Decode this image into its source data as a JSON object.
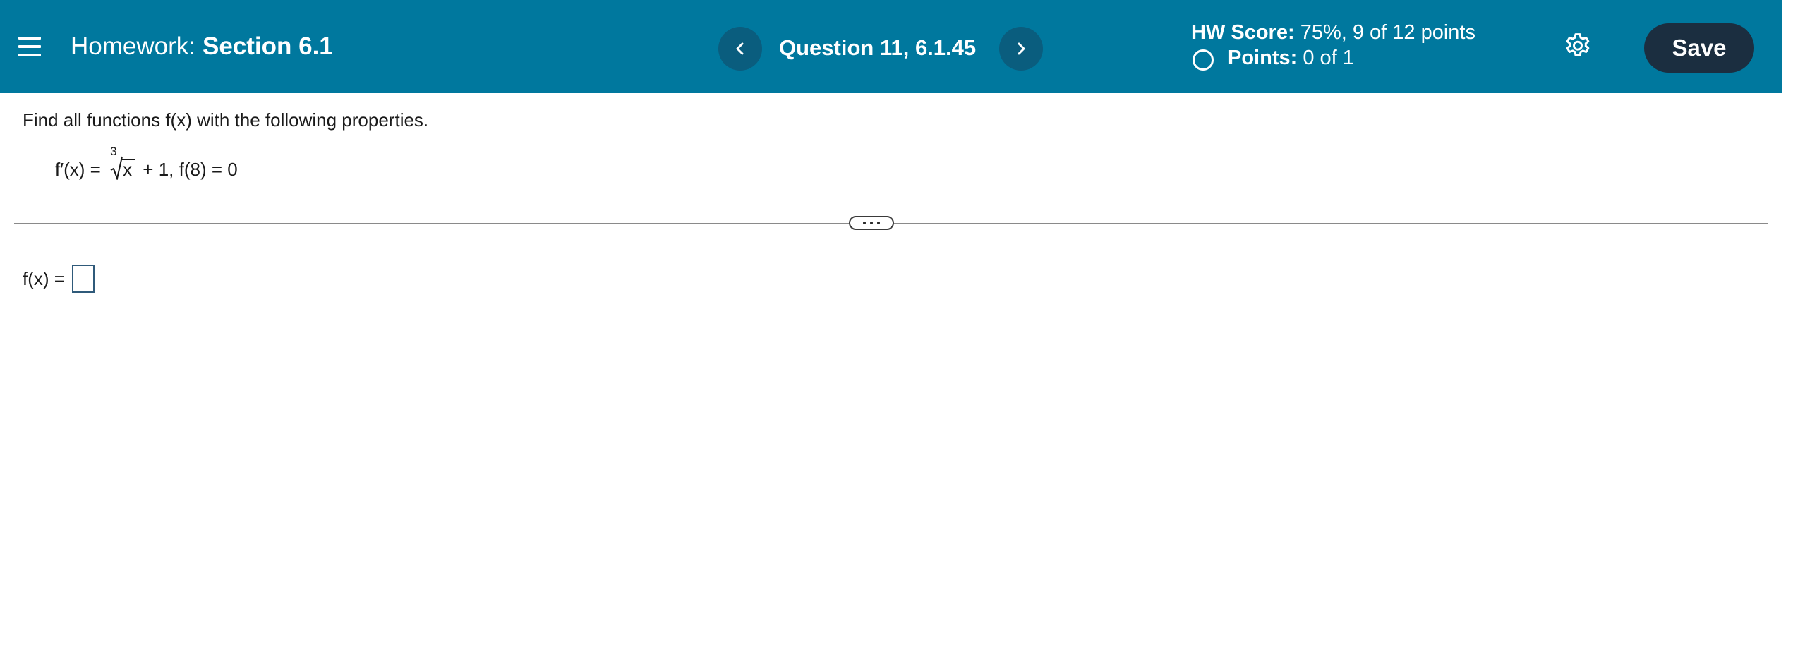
{
  "header": {
    "menu_icon": "hamburger-menu-icon",
    "homework_prefix": "Homework:",
    "homework_name": "Section 6.1",
    "prev_icon": "chevron-left-icon",
    "next_icon": "chevron-right-icon",
    "question_label": "Question 11, 6.1.45",
    "score_label": "HW Score:",
    "score_value": "75%, 9 of 12 points",
    "points_label": "Points:",
    "points_value": "0 of 1",
    "settings_icon": "gear-icon",
    "save_label": "Save",
    "bar_color": "#00789e",
    "save_color": "#1b2e40"
  },
  "question": {
    "instructions": "Find all functions f(x) with the following properties.",
    "eq_lhs": "f′(x) =",
    "root_index": "3",
    "radicand": "x",
    "eq_rest": "+ 1, f(8) = 0"
  },
  "divider": {
    "expand_icon": "ellipsis-icon"
  },
  "answer": {
    "label": "f(x) =",
    "value": ""
  }
}
